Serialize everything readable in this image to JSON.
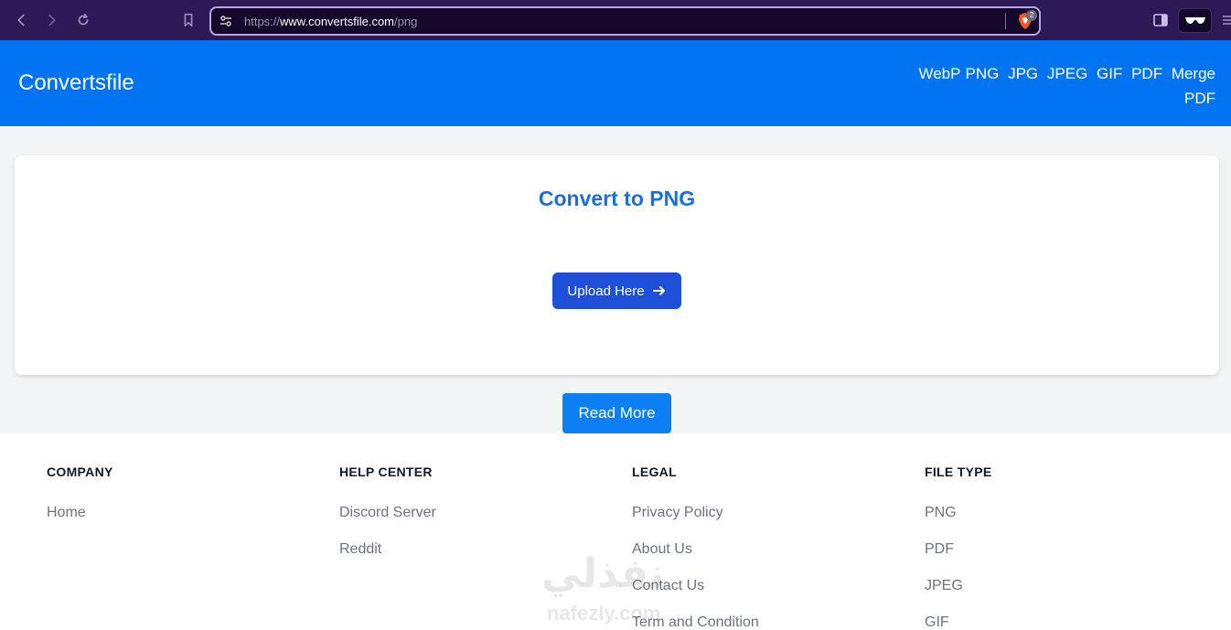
{
  "browser": {
    "url_scheme": "https://",
    "url_host": "www.convertsfile.com",
    "url_path": "/png",
    "shield_count": "2"
  },
  "header": {
    "brand": "Convertsfile",
    "nav": [
      "WebP",
      "PNG",
      "JPG",
      "JPEG",
      "GIF",
      "PDF",
      "Merge PDF"
    ]
  },
  "converter": {
    "title": "Convert to PNG",
    "upload_label": "Upload Here"
  },
  "read_more_label": "Read More",
  "footer": {
    "columns": [
      {
        "heading": "COMPANY",
        "links": [
          "Home"
        ]
      },
      {
        "heading": "HELP CENTER",
        "links": [
          "Discord Server",
          "Reddit"
        ]
      },
      {
        "heading": "LEGAL",
        "links": [
          "Privacy Policy",
          "About Us",
          "Contact Us",
          "Term and Condition"
        ]
      },
      {
        "heading": "FILE TYPE",
        "links": [
          "PNG",
          "PDF",
          "JPEG",
          "GIF"
        ]
      }
    ]
  },
  "watermark": {
    "arabic": "نفذلي",
    "latin": "nafezly.com"
  },
  "colors": {
    "header_bg": "#0073f0",
    "title": "#1b6fd6",
    "upload_btn": "#1d4fd8",
    "read_more_btn": "#0d7ff5"
  }
}
